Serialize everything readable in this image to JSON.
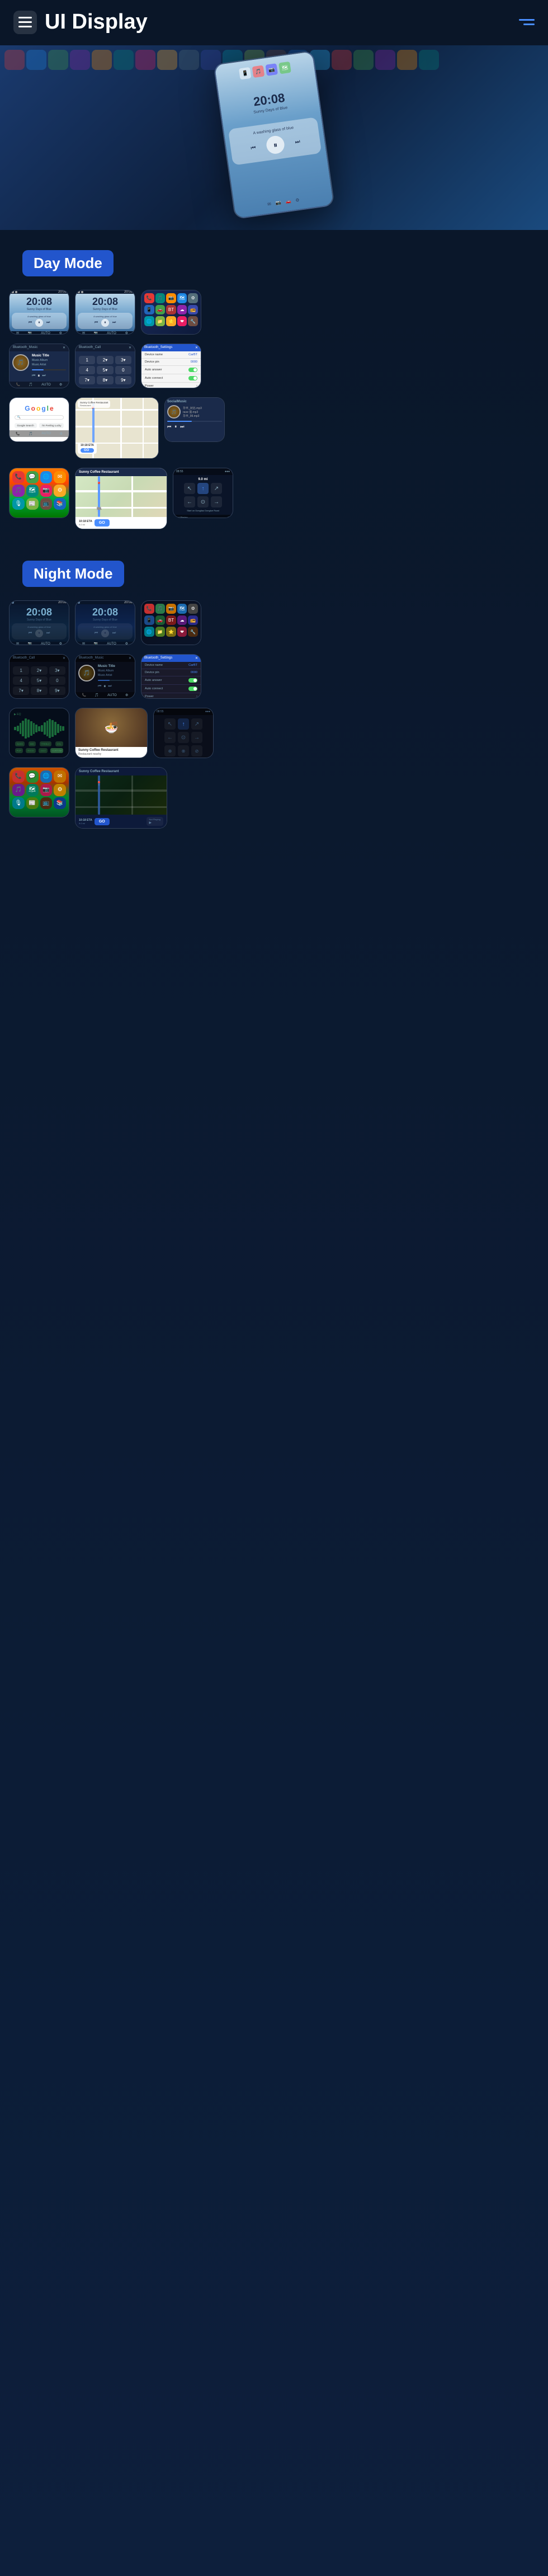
{
  "header": {
    "title": "UI Display",
    "menu_label": "menu",
    "nav_label": "navigation"
  },
  "sections": {
    "day_mode": {
      "label": "Day Mode",
      "screens": {
        "home1": {
          "time": "20:08",
          "subtitle": "Sunny Days of Blue"
        },
        "home2": {
          "time": "20:08",
          "subtitle": "Sunny Days of Blue"
        }
      }
    },
    "night_mode": {
      "label": "Night Mode",
      "screens": {
        "home1": {
          "time": "20:08",
          "subtitle": "Sunny Days of Blue"
        },
        "home2": {
          "time": "20:08",
          "subtitle": "Sunny Days of Blue"
        }
      }
    }
  },
  "music": {
    "title": "Music Title",
    "album": "Music Album",
    "artist": "Music Artist"
  },
  "navigation": {
    "destination": "Sunny Coffee Restaurant",
    "eta": "10:18 ETA",
    "distance": "9.0 mi",
    "go_label": "GO",
    "direction": "Start on Dongliao Donglue Road"
  },
  "settings_rows": [
    {
      "label": "Device name",
      "value": "CarBT",
      "has_toggle": false
    },
    {
      "label": "Device pin",
      "value": "0000",
      "has_toggle": false
    },
    {
      "label": "Auto answer",
      "value": "",
      "has_toggle": true,
      "on": true
    },
    {
      "label": "Auto connect",
      "value": "",
      "has_toggle": true,
      "on": true
    },
    {
      "label": "Power",
      "value": "",
      "has_toggle": false
    }
  ],
  "social_items": [
    "华平_对比.mp3",
    "rave 华平_对比__ost_rave_混.mp3",
    "华平_对比_55_99.mp3"
  ],
  "call_keypad": [
    [
      "1",
      "2",
      "3"
    ],
    [
      "4",
      "5",
      "6"
    ],
    [
      "7",
      "8",
      "9"
    ],
    [
      "*",
      "0",
      "#"
    ]
  ],
  "wave_bars": [
    3,
    6,
    12,
    18,
    24,
    30,
    35,
    28,
    20,
    14,
    8,
    5,
    9,
    16,
    22,
    28,
    32,
    25,
    18,
    12,
    7,
    10,
    20,
    30,
    35,
    28,
    18,
    10,
    6,
    4
  ],
  "app_colors": {
    "row1": [
      "app-red",
      "app-green",
      "app-blue",
      "app-purple",
      "app-orange"
    ],
    "row2": [
      "app-teal",
      "app-pink",
      "app-yellow",
      "app-gray",
      "app-indigo"
    ],
    "row3": [
      "app-cyan",
      "app-lime",
      "app-brown",
      "app-deepblue",
      "app-lightblue"
    ]
  }
}
